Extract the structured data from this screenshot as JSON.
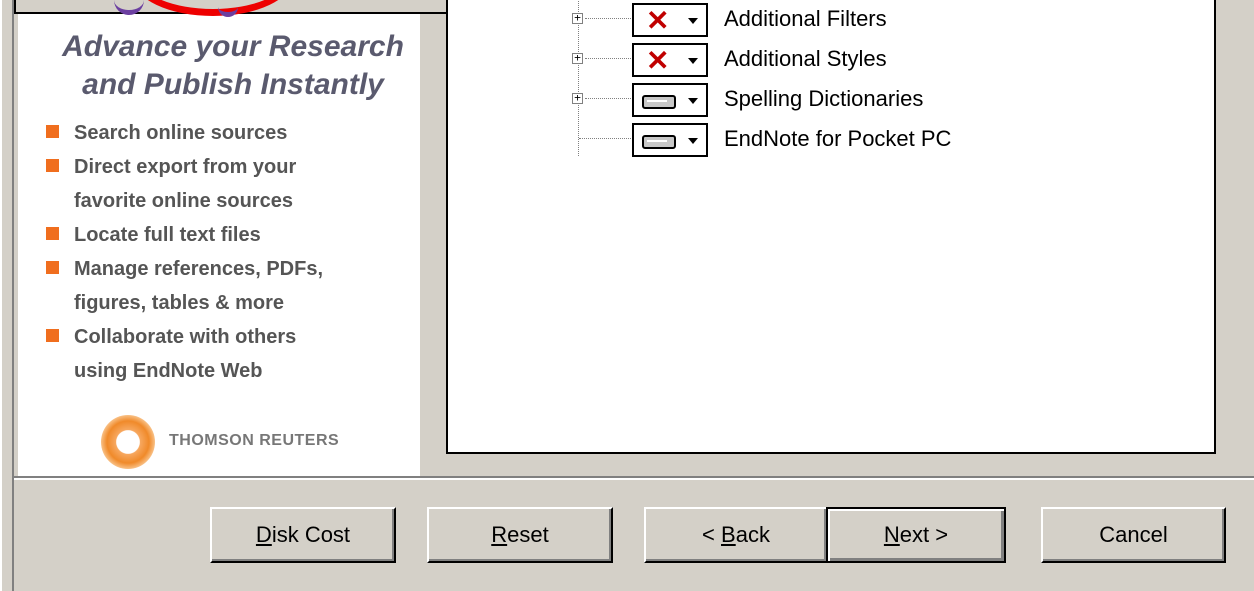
{
  "sidebar": {
    "headline_line1": "Advance your Research",
    "headline_line2": "and Publish Instantly",
    "features": [
      {
        "line1": "Search online sources",
        "line2": ""
      },
      {
        "line1": "Direct export from your",
        "line2": "favorite online sources"
      },
      {
        "line1": "Locate full text files",
        "line2": ""
      },
      {
        "line1": "Manage references, PDFs,",
        "line2": "figures, tables & more"
      },
      {
        "line1": "Collaborate with others",
        "line2": "using EndNote Web"
      }
    ],
    "brand": "THOMSON REUTERS",
    "bullet_color": "#f06e1e"
  },
  "tree": {
    "items": [
      {
        "label": "Additional Filters",
        "state": "not-installed",
        "state_icon": "red-x-icon",
        "expandable": true
      },
      {
        "label": "Additional Styles",
        "state": "not-installed",
        "state_icon": "red-x-icon",
        "expandable": true
      },
      {
        "label": "Spelling Dictionaries",
        "state": "install-local",
        "state_icon": "hard-drive-icon",
        "expandable": true
      },
      {
        "label": "EndNote for Pocket PC",
        "state": "install-local",
        "state_icon": "hard-drive-icon",
        "expandable": false
      }
    ],
    "expand_glyph": "+",
    "x_glyph": "✕"
  },
  "buttons": {
    "disk_cost": {
      "mnemonic": "D",
      "rest": "isk Cost"
    },
    "reset": {
      "mnemonic": "R",
      "rest": "eset"
    },
    "back": {
      "prefix": "< ",
      "mnemonic": "B",
      "rest": "ack"
    },
    "next": {
      "mnemonic": "N",
      "rest": "ext >"
    },
    "cancel": {
      "label": "Cancel"
    }
  }
}
